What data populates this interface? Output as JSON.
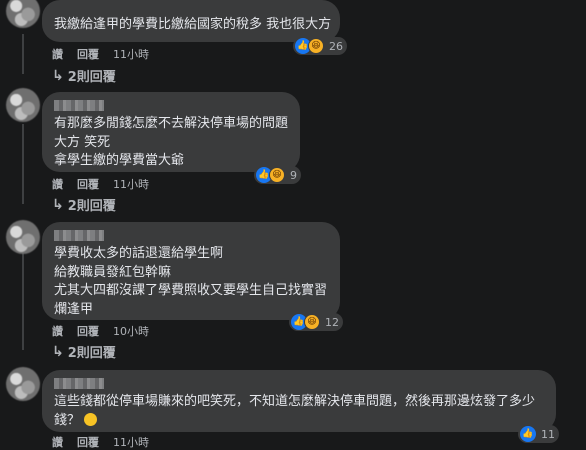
{
  "comments": [
    {
      "lines": [
        "我繳給逢甲的學費比繳給國家的稅多 我也很大方"
      ],
      "reaction_count": "26",
      "actions": {
        "like": "讚",
        "reply": "回覆",
        "time": "11小時"
      },
      "replies_label": "2則回覆"
    },
    {
      "lines": [
        "有那麼多閒錢怎麼不去解決停車場的問題",
        "大方 笑死",
        "拿學生繳的學費當大爺"
      ],
      "reaction_count": "9",
      "actions": {
        "like": "讚",
        "reply": "回覆",
        "time": "11小時"
      },
      "replies_label": "2則回覆"
    },
    {
      "lines": [
        "學費收太多的話退還給學生啊",
        "給教職員發紅包幹嘛",
        "尤其大四都沒課了學費照收又要學生自己找實習",
        "爛逢甲"
      ],
      "reaction_count": "12",
      "actions": {
        "like": "讚",
        "reply": "回覆",
        "time": "10小時"
      },
      "replies_label": "2則回覆"
    },
    {
      "lines": [
        "這些錢都從停車場賺來的吧笑死，不知道怎麼解決停車問題，然後再那邊炫發了多少",
        "錢？"
      ],
      "reaction_count": "11",
      "actions": {
        "like": "讚",
        "reply": "回覆",
        "time": "11小時"
      }
    }
  ],
  "colors": {
    "background": "#18191a",
    "bubble": "#3a3b3c",
    "like": "#1877f2",
    "haha": "#f7b125"
  }
}
